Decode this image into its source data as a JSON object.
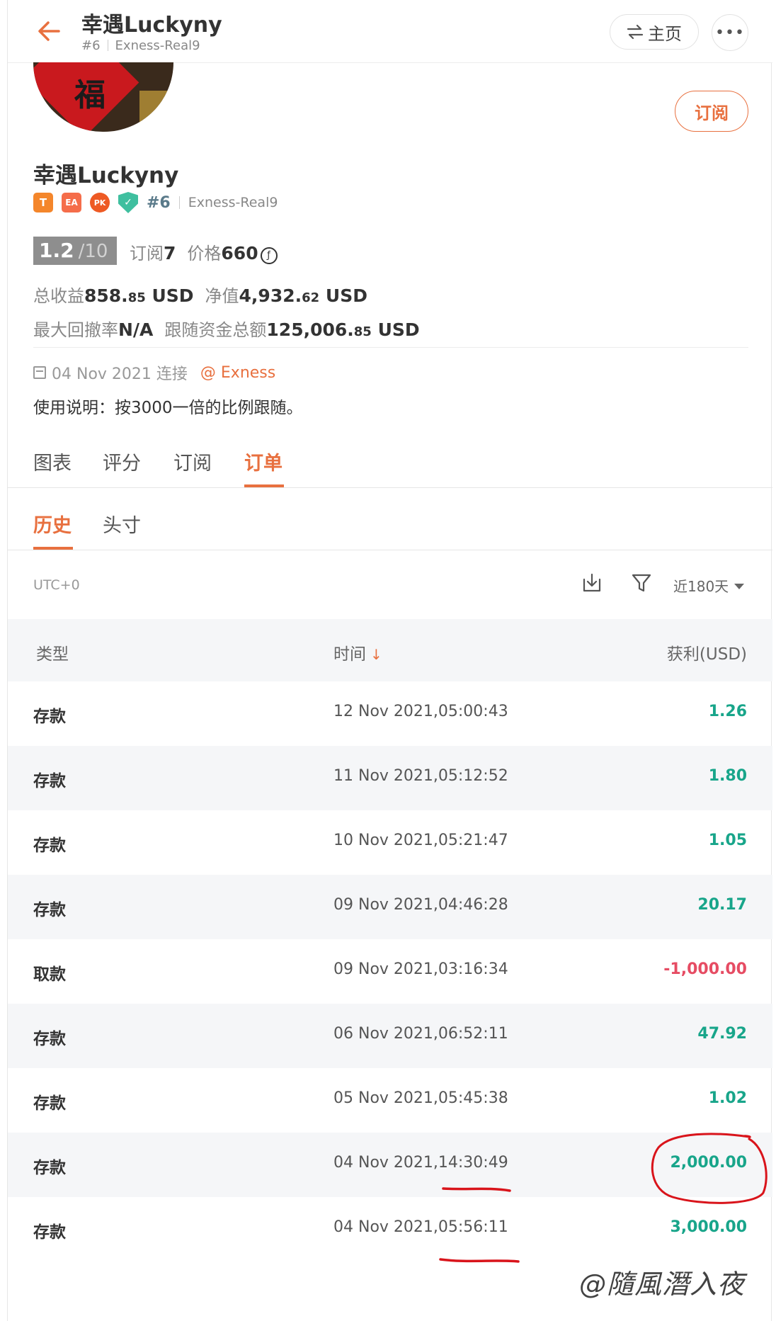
{
  "header": {
    "title": "幸遇Luckyny",
    "rank": "#6",
    "account": "Exness-Real9",
    "home_label": "主页",
    "more_label": "•••"
  },
  "profile": {
    "subscribe_label": "订阅",
    "name": "幸遇Luckyny",
    "badges": {
      "t": "T",
      "ea": "EA",
      "pk": "PK"
    },
    "rank": "#6",
    "account": "Exness-Real9",
    "score": "1.2",
    "score_max": "/10",
    "subs_label": "订阅",
    "subs_value": "7",
    "price_label": "价格",
    "price_value": "660",
    "price_coin": "ƒ",
    "total_profit_label": "总收益",
    "total_profit_int": "858.",
    "total_profit_dec": "85",
    "total_profit_unit": "USD",
    "equity_label": "净值",
    "equity_int": "4,932.",
    "equity_dec": "62",
    "equity_unit": "USD",
    "drawdown_label": "最大回撤率",
    "drawdown_value": "N/A",
    "follow_label": "跟随资金总额",
    "follow_int": "125,006.",
    "follow_dec": "85",
    "follow_unit": "USD",
    "connected_date": "04 Nov 2021 连接",
    "broker": "@ Exness",
    "usage": "使用说明：按3000一倍的比例跟随。"
  },
  "tabs": [
    "图表",
    "评分",
    "订阅",
    "订单"
  ],
  "subtabs": [
    "历史",
    "头寸"
  ],
  "toolbar": {
    "timezone": "UTC+0",
    "range": "近180天"
  },
  "table": {
    "headers": {
      "type": "类型",
      "time": "时间",
      "profit": "获利(USD)"
    },
    "rows": [
      {
        "type": "存款",
        "time": "12 Nov 2021,05:00:43",
        "profit": "1.26"
      },
      {
        "type": "存款",
        "time": "11 Nov 2021,05:12:52",
        "profit": "1.80"
      },
      {
        "type": "存款",
        "time": "10 Nov 2021,05:21:47",
        "profit": "1.05"
      },
      {
        "type": "存款",
        "time": "09 Nov 2021,04:46:28",
        "profit": "20.17"
      },
      {
        "type": "取款",
        "time": "09 Nov 2021,03:16:34",
        "profit": "-1,000.00"
      },
      {
        "type": "存款",
        "time": "06 Nov 2021,06:52:11",
        "profit": "47.92"
      },
      {
        "type": "存款",
        "time": "05 Nov 2021,05:45:38",
        "profit": "1.02"
      },
      {
        "type": "存款",
        "time": "04 Nov 2021,14:30:49",
        "profit": "2,000.00"
      },
      {
        "type": "存款",
        "time": "04 Nov 2021,05:56:11",
        "profit": "3,000.00"
      }
    ]
  },
  "colors": {
    "accent": "#e8703f",
    "positive": "#18a58a",
    "negative": "#e64c63",
    "annotation": "#d9141b"
  },
  "watermark": "@隨風潛入夜"
}
